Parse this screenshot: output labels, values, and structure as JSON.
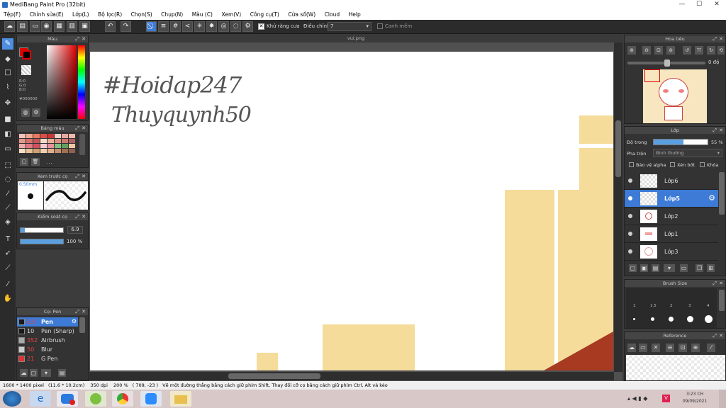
{
  "window": {
    "title": "MediBang Paint Pro (32bit)"
  },
  "menu": [
    "Tệp(F)",
    "Chỉnh sửa(E)",
    "Lớp(L)",
    "Bộ lọc(R)",
    "Chọn(S)",
    "Chụp(N)",
    "Màu (C)",
    "Xem(V)",
    "Công cụ(T)",
    "Cửa sổ(W)",
    "Cloud",
    "Help"
  ],
  "toolbar": {
    "antialias_label": "Khử răng cưa",
    "correction_label": "Điều chỉnh",
    "correction_value": "7",
    "snap_label": "Canh mềm"
  },
  "color_panel": {
    "title": "Màu",
    "r": "R:0",
    "g": "G:0",
    "b": "B:0",
    "hex": "#000000",
    "primary_color": "#000000",
    "accent_color": "#e00000"
  },
  "palette_panel": {
    "title": "Bảng màu",
    "dots": "..."
  },
  "brush_preview": {
    "title": "Xem trước cọ",
    "size": "0.50mm"
  },
  "brush_control": {
    "title": "Kiểm soát cọ",
    "size_value": "6.9",
    "opacity_value": "100 %"
  },
  "brush_list": {
    "title": "Cọ: Pen",
    "items": [
      {
        "size": "6.9",
        "name": "Pen",
        "color": "#1a1a1a",
        "selected": true
      },
      {
        "size": "10",
        "name": "Pen (Sharp)",
        "color": "#1a1a1a"
      },
      {
        "size": "352",
        "name": "Airbrush",
        "color": "#aaaaaa"
      },
      {
        "size": "50",
        "name": "Blur",
        "color": "#cccccc"
      },
      {
        "size": "21",
        "name": "G Pen",
        "color": "#e03030"
      }
    ]
  },
  "document": {
    "tab": "vui.png"
  },
  "canvas_text": {
    "line1": "#Hoidap247",
    "line2": "Thuyquynh50"
  },
  "navigator": {
    "title": "Hoa tiêu",
    "rotation": "0 độ"
  },
  "layer_panel": {
    "title": "Lớp",
    "opacity_label": "Độ trong",
    "opacity_value": "55 %",
    "opacity_fraction": 0.55,
    "blend_label": "Pha trộn",
    "blend_value": "Bình thường",
    "protect_alpha": "Bảo vệ alpha",
    "clipping": "Xén bớt",
    "lock": "Khóa",
    "layers": [
      {
        "name": "Lớp6",
        "selected": false
      },
      {
        "name": "Lớp5",
        "selected": true
      },
      {
        "name": "Lớp2",
        "selected": false
      },
      {
        "name": "Lớp1",
        "selected": false
      },
      {
        "name": "Lớp3",
        "selected": false
      }
    ]
  },
  "brush_size_panel": {
    "title": "Brush Size",
    "labels": [
      "1",
      "1.5",
      "2",
      "3",
      "4"
    ]
  },
  "reference_panel": {
    "title": "Reference"
  },
  "status": {
    "dimensions": "1600 * 1400 pixel",
    "physical": "(11.6 * 10.2cm)",
    "dpi": "350 dpi",
    "zoom": "200 %",
    "coords": "( 709, -23 )",
    "hint": "Vẽ một đường thẳng bằng cách giữ phím Shift, Thay đổi cỡ cọ bằng cách giữ phím Ctrl, Alt và kéo"
  },
  "taskbar": {
    "time": "3:23 CH",
    "date": "09/09/2021"
  }
}
